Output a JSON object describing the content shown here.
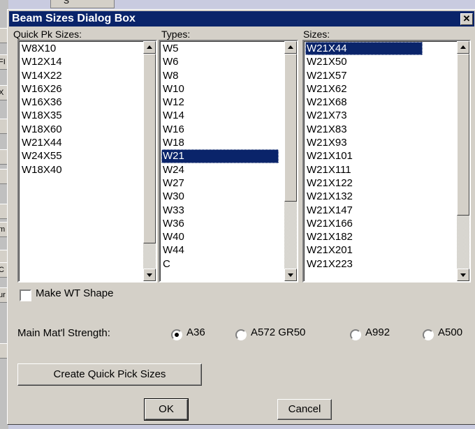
{
  "background_app": {
    "top_label": "S",
    "strip_cells": [
      "",
      "FI",
      "X",
      "",
      "",
      "",
      "",
      "m",
      "",
      "C",
      "ur",
      ""
    ]
  },
  "dialog": {
    "title": "Beam Sizes Dialog Box",
    "close_glyph": "✕"
  },
  "quick_pick": {
    "label": "Quick Pk Sizes:",
    "items": [
      "W8X10",
      "W12X14",
      "W14X22",
      "W16X26",
      "W16X36",
      "W18X35",
      "W18X60",
      "W21X44",
      "W24X55",
      "W18X40"
    ]
  },
  "types": {
    "label": "Types:",
    "items": [
      "W5",
      "W6",
      "W8",
      "W10",
      "W12",
      "W14",
      "W16",
      "W18",
      "W21",
      "W24",
      "W27",
      "W30",
      "W33",
      "W36",
      "W40",
      "W44",
      "C"
    ],
    "selected": "W21"
  },
  "sizes": {
    "label": "Sizes:",
    "items": [
      "W21X44",
      "W21X50",
      "W21X57",
      "W21X62",
      "W21X68",
      "W21X73",
      "W21X83",
      "W21X93",
      "W21X101",
      "W21X111",
      "W21X122",
      "W21X132",
      "W21X147",
      "W21X166",
      "W21X182",
      "W21X201",
      "W21X223"
    ],
    "selected": "W21X44"
  },
  "wt_shape": {
    "label": "Make WT Shape",
    "checked": false
  },
  "strength": {
    "label": "Main Mat'l Strength:",
    "options": [
      "A36",
      "A572 GR50",
      "A992",
      "A500"
    ],
    "selected": "A36"
  },
  "buttons": {
    "create": "Create Quick Pick Sizes",
    "ok": "OK",
    "cancel": "Cancel"
  }
}
